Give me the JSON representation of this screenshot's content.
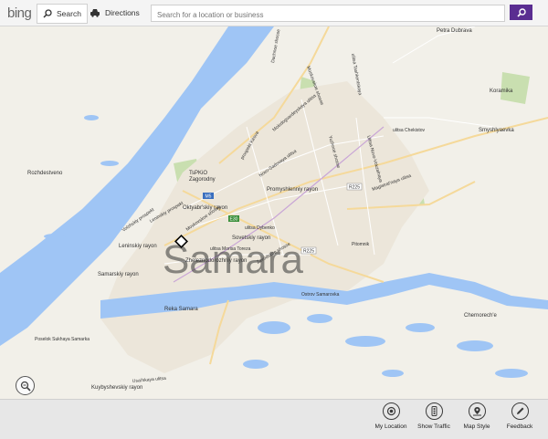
{
  "header": {
    "logo": "bing",
    "search_tab": "Search",
    "directions_tab": "Directions",
    "search_placeholder": "Search for a location or business",
    "search_icon": "magnifier-icon"
  },
  "map": {
    "city_label": "Samara",
    "places": {
      "petra_dubrava": "Petra Dubrava",
      "koramika": "Koramika",
      "smyshlyaevka": "Smyshlyaevka",
      "rozhdestveno": "Rozhdestveno",
      "tupuo": "TsPKiO",
      "zagorodny": "Zagorodny",
      "oktyabrsky": "Oktyabr'skiy rayon",
      "promyshlenny": "Promyshlenniy rayon",
      "leninsky": "Leninskiy rayon",
      "sovetsky": "Sovetskiy rayon",
      "zheleznodorozhny": "Zheleznodorozhniy rayon",
      "samarsky": "Samarskiy rayon",
      "kuibyshevsky": "Kuybyshevskiy rayon",
      "chernorechye": "Chernorech'e",
      "volga": "Reka Samara",
      "pitomnik": "Pitomnik",
      "samarovka": "Ostrov Samarovka",
      "kuibyshev_settle": "Poselok Sukhaya Samarka"
    },
    "streets": {
      "s1": "Dachnoe shosse",
      "s2": "Moskovskoe shosse",
      "s3": "ulitsa Tashkentskaya",
      "s4": "prospekt Kirova",
      "s5": "Novo-Sadovaya ulitsa",
      "s6": "Molodogvardeyskaya ulitsa",
      "s7": "ulitsa Chekistov",
      "s8": "Volzhskiy prospekt",
      "s9": "Leninskiy prospekt",
      "s10": "Moskovskoe shosse",
      "s11": "ulitsa Dybenko",
      "s12": "ulitsa Morisa Toreza",
      "s13": "Zavodskoe shosse",
      "s14": "Yuzhnoe shosse",
      "s15": "Ulitsa Novo-Vokzalnaya",
      "s16": "Magistral'naya ulitsa",
      "s17": "Usal'skaya ulitsa"
    },
    "roads": {
      "m5": "M5",
      "e30": "E30",
      "r225": "R225",
      "r225b": "R225"
    }
  },
  "appbar": {
    "my_location": "My Location",
    "show_traffic": "Show Traffic",
    "map_style": "Map Style",
    "feedback": "Feedback"
  },
  "colors": {
    "water": "#9fc5f5",
    "land": "#f2f0e9",
    "park": "#c9dfb0",
    "accent": "#5a2d91"
  }
}
